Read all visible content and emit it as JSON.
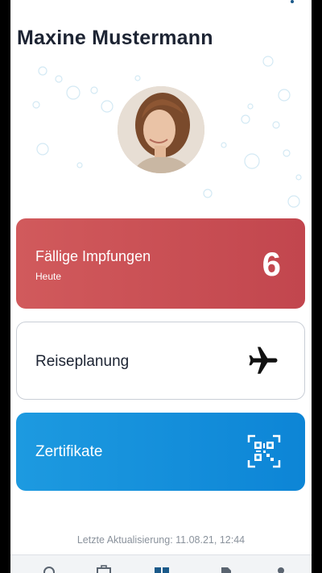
{
  "header": {
    "name": "Maxine Mustermann"
  },
  "cards": {
    "due": {
      "label": "Fällige Impfungen",
      "sub": "Heute",
      "count": "6"
    },
    "travel": {
      "label": "Reiseplanung",
      "icon": "airplane-icon"
    },
    "certificates": {
      "label": "Zertifikate",
      "icon": "qr-code-icon"
    }
  },
  "footer": {
    "last_update": "Letzte Aktualisierung: 11.08.21, 12:44"
  },
  "tabbar": {
    "items": [
      "virus-icon",
      "briefcase-icon",
      "dashboard-icon",
      "document-icon",
      "person-icon"
    ],
    "active": "dashboard-icon"
  },
  "colors": {
    "due_card": "#c94f55",
    "cert_card": "#1a92de",
    "title": "#1d2433",
    "accent": "#1b5a8a"
  }
}
